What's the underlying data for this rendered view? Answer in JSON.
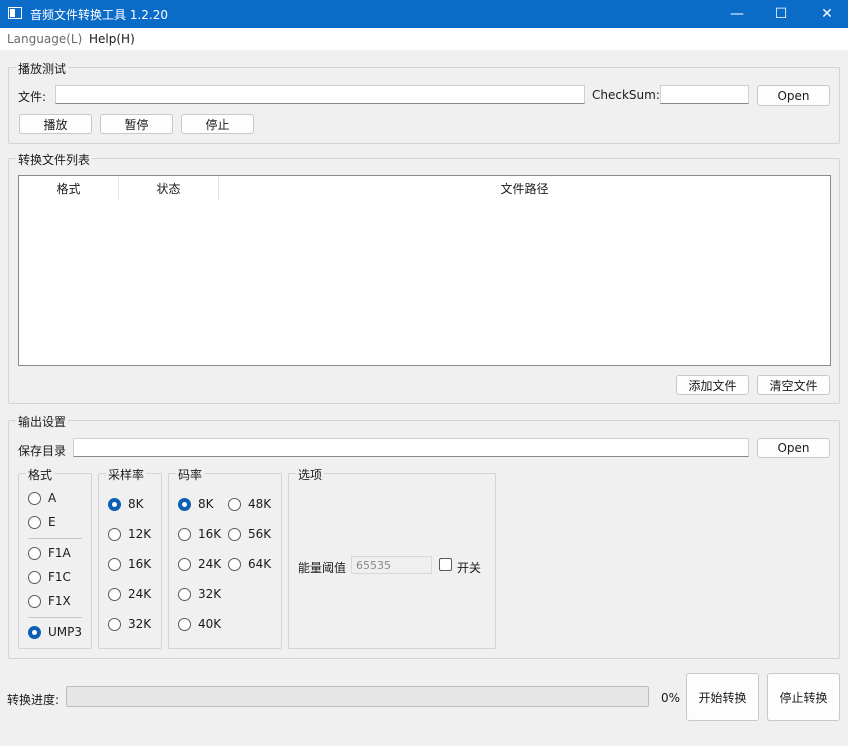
{
  "window": {
    "title": "音频文件转换工具 1.2.20",
    "controls": [
      "—",
      "☐",
      "✕"
    ]
  },
  "menu": {
    "items": [
      "Language(L)",
      "Help(H)"
    ]
  },
  "play_test": {
    "title": "播放测试",
    "file_label": "文件:",
    "file_value": "",
    "checksum_label": "CheckSum:",
    "checksum_value": "",
    "open_label": "Open",
    "play_label": "播放",
    "pause_label": "暂停",
    "stop_label": "停止"
  },
  "file_list": {
    "title": "转换文件列表",
    "columns": [
      "格式",
      "状态",
      "文件路径"
    ],
    "rows": [],
    "add_label": "添加文件",
    "clear_label": "清空文件"
  },
  "output": {
    "title": "输出设置",
    "dir_label": "保存目录",
    "dir_value": "",
    "open_label": "Open",
    "format": {
      "title": "格式",
      "options": [
        "A",
        "E",
        "F1A",
        "F1C",
        "F1X",
        "UMP3"
      ],
      "selected": "UMP3"
    },
    "sample_rate": {
      "title": "采样率",
      "options": [
        "8K",
        "12K",
        "16K",
        "24K",
        "32K"
      ],
      "selected": "8K"
    },
    "bitrate": {
      "title": "码率",
      "options": [
        "8K",
        "16K",
        "24K",
        "32K",
        "40K",
        "48K",
        "56K",
        "64K"
      ],
      "selected": "8K"
    },
    "options": {
      "title": "选项",
      "energy_label": "能量阈值",
      "energy_value": "65535",
      "switch_label": "开关",
      "switch_checked": false
    }
  },
  "bottom": {
    "progress_label": "转换进度:",
    "progress_percent": 0,
    "progress_text": "0%",
    "start_label": "开始转换",
    "stop_label": "停止转换"
  },
  "colors": {
    "titlebar": "#0b6cc8",
    "accent": "#0b5fb5",
    "window_bg": "#f0f0f0"
  }
}
